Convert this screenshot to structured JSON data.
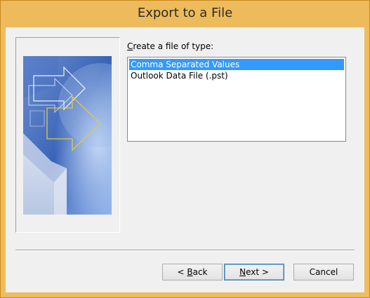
{
  "window": {
    "title": "Export to a File"
  },
  "list": {
    "label_prefix_underlined": "C",
    "label_rest": "reate a file of type:",
    "items": [
      {
        "label": "Comma Separated Values",
        "selected": true
      },
      {
        "label": "Outlook Data File (.pst)",
        "selected": false
      }
    ]
  },
  "buttons": {
    "back": {
      "prefix": "< ",
      "underlined": "B",
      "rest": "ack"
    },
    "next": {
      "prefix": "",
      "underlined": "N",
      "rest": "ext >"
    },
    "cancel": {
      "label": "Cancel"
    }
  },
  "colors": {
    "titlebar": "#edbb5b",
    "selection": "#3399ff",
    "dialog_bg": "#f0f0f0"
  }
}
